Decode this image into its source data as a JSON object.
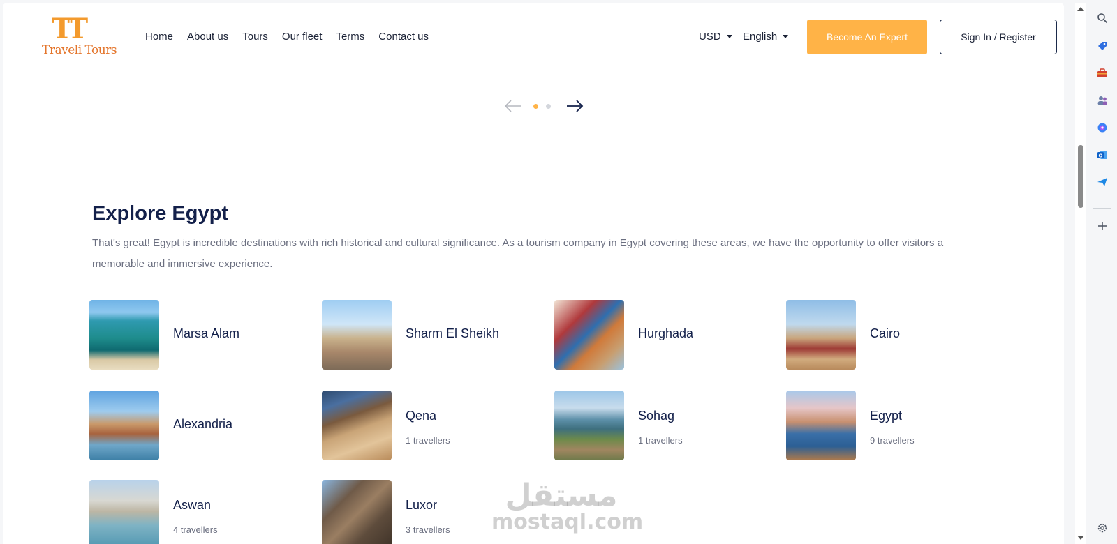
{
  "logo": {
    "mark": "TT",
    "text": "Traveli Tours"
  },
  "nav": [
    {
      "label": "Home"
    },
    {
      "label": "About us"
    },
    {
      "label": "Tours"
    },
    {
      "label": "Our fleet"
    },
    {
      "label": "Terms"
    },
    {
      "label": "Contact us"
    }
  ],
  "currency": {
    "selected": "USD"
  },
  "language": {
    "selected": "English"
  },
  "buttons": {
    "expert": "Become An Expert",
    "signin": "Sign In / Register"
  },
  "slider": {
    "active_index": 1,
    "total": 2
  },
  "section": {
    "title": "Explore Egypt",
    "description": "That's great! Egypt is incredible destinations with rich historical and cultural significance. As a tourism company in Egypt covering these areas, we have the opportunity to offer visitors a memorable and immersive experience."
  },
  "destinations": [
    {
      "name": "Marsa Alam",
      "count": ""
    },
    {
      "name": "Sharm El Sheikh",
      "count": ""
    },
    {
      "name": "Hurghada",
      "count": ""
    },
    {
      "name": "Cairo",
      "count": ""
    },
    {
      "name": "Alexandria",
      "count": ""
    },
    {
      "name": "Qena",
      "count": "1 travellers"
    },
    {
      "name": "Sohag",
      "count": "1 travellers"
    },
    {
      "name": "Egypt",
      "count": "9 travellers"
    },
    {
      "name": "Aswan",
      "count": "4 travellers"
    },
    {
      "name": "Luxor",
      "count": "3 travellers"
    }
  ],
  "watermark": {
    "arabic": "مستقل",
    "latin": "mostaql.com"
  },
  "sidebar_icons": [
    "search-icon",
    "tag-icon",
    "toolbox-icon",
    "people-icon",
    "copilot-icon",
    "outlook-icon",
    "send-icon",
    "plus-icon",
    "settings-icon"
  ],
  "colors": {
    "accent": "#ffb347",
    "navy": "#13204a",
    "text_muted": "#6b6f80"
  }
}
